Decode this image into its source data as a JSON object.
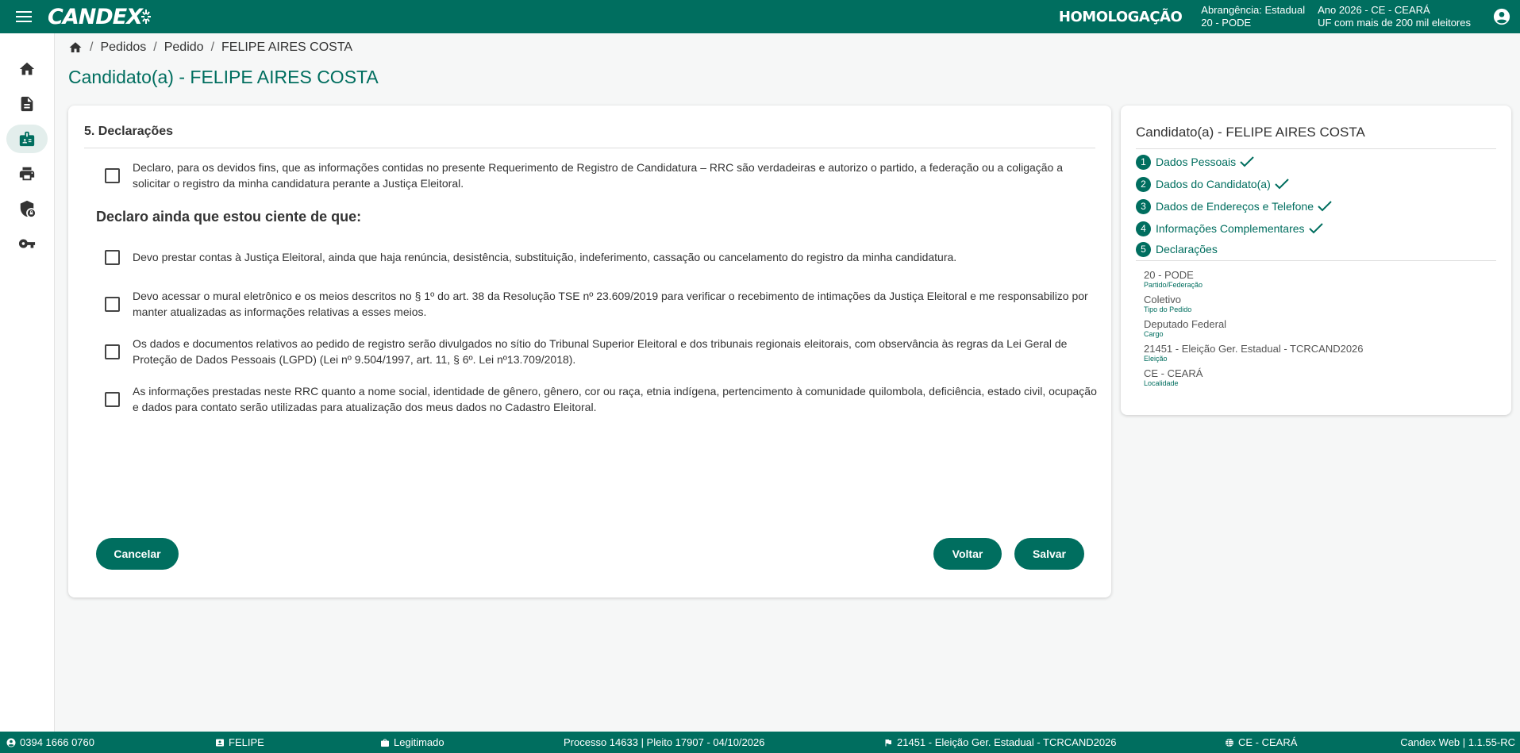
{
  "app": {
    "logo": "CANDEX",
    "environment": "HOMOLOGAÇÃO",
    "scope_line1": "Abrangência: Estadual",
    "scope_line2": "20 - PODE",
    "year_line1": "Ano 2026 - CE - CEARÁ",
    "year_line2": "UF com mais de 200 mil eleitores"
  },
  "sidebar": {
    "items": [
      {
        "icon": "home-icon"
      },
      {
        "icon": "document-icon"
      },
      {
        "icon": "badge-icon",
        "active": true
      },
      {
        "icon": "printer-icon"
      },
      {
        "icon": "shield-lock-icon"
      },
      {
        "icon": "key-icon"
      }
    ]
  },
  "breadcrumb": {
    "items": [
      "Pedidos",
      "Pedido",
      "FELIPE AIRES COSTA"
    ]
  },
  "page": {
    "title": "Candidato(a) - FELIPE AIRES COSTA"
  },
  "declarations": {
    "section_title": "5. Declarações",
    "main": "Declaro, para os devidos fins, que as informações contidas no presente Requerimento de Registro de Candidatura – RRC são verdadeiras e autorizo o partido, a federação ou a coligação a solicitar o registro da minha candidatura perante a Justiça Eleitoral.",
    "subheading": "Declaro ainda que estou ciente de que:",
    "items": [
      "Devo prestar contas à Justiça Eleitoral, ainda que haja renúncia, desistência, substituição, indeferimento, cassação ou cancelamento do registro da minha candidatura.",
      "Devo acessar o mural eletrônico e os meios descritos no § 1º do art. 38 da Resolução TSE nº 23.609/2019 para verificar o recebimento de intimações da Justiça Eleitoral e me responsabilizo por manter atualizadas as informações relativas a esses meios.",
      "Os dados e documentos relativos ao pedido de registro serão divulgados no sítio do Tribunal Superior Eleitoral e dos tribunais regionais eleitorais, com observância às regras da Lei Geral de Proteção de Dados Pessoais (LGPD) (Lei nº 9.504/1997, art. 11, § 6º. Lei nº13.709/2018).",
      "As informações prestadas neste RRC quanto a nome social, identidade de gênero, gênero, cor ou raça, etnia indígena, pertencimento à comunidade quilombola, deficiência, estado civil, ocupação e dados para contato serão utilizadas para atualização dos meus dados no Cadastro Eleitoral."
    ]
  },
  "buttons": {
    "cancel": "Cancelar",
    "back": "Voltar",
    "save": "Salvar"
  },
  "summary": {
    "title": "Candidato(a) - FELIPE AIRES COSTA",
    "steps": [
      {
        "num": "1",
        "label": "Dados Pessoais",
        "done": true
      },
      {
        "num": "2",
        "label": "Dados do Candidato(a)",
        "done": true
      },
      {
        "num": "3",
        "label": "Dados de Endereços e Telefone",
        "done": true
      },
      {
        "num": "4",
        "label": "Informações Complementares",
        "done": true
      },
      {
        "num": "5",
        "label": "Declarações",
        "done": false
      }
    ],
    "info": [
      {
        "value": "20 - PODE",
        "label": "Partido/Federação"
      },
      {
        "value": "Coletivo",
        "label": "Tipo do Pedido"
      },
      {
        "value": "Deputado Federal",
        "label": "Cargo"
      },
      {
        "value": "21451 - Eleição Ger. Estadual - TCRCAND2026",
        "label": "Eleição"
      },
      {
        "value": "CE - CEARÁ",
        "label": "Localidade"
      }
    ]
  },
  "footer": {
    "phone": "0394 1666 0760",
    "user": "FELIPE",
    "role": "Legitimado",
    "process": "Processo 14633 | Pleito 17907 - 04/10/2026",
    "election": "21451 - Eleição Ger. Estadual - TCRCAND2026",
    "location": "CE - CEARÁ",
    "version": "Candex Web | 1.1.55-RC"
  },
  "colors": {
    "primary": "#006e5f",
    "background": "#f6f7f7"
  }
}
